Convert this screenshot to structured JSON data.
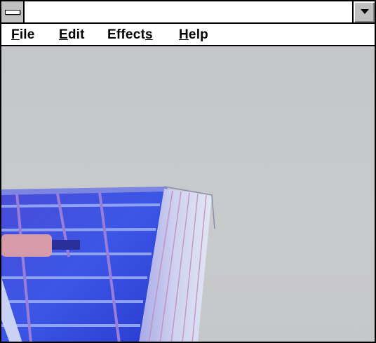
{
  "window": {
    "title": ""
  },
  "menu": {
    "file": {
      "label": "File",
      "access": "F",
      "rest": "ile"
    },
    "edit": {
      "label": "Edit",
      "access": "E",
      "rest": "dit"
    },
    "effects": {
      "label": "Effects",
      "pre": "Effect",
      "access": "s",
      "post": ""
    },
    "help": {
      "label": "Help",
      "access": "H",
      "rest": "elp"
    }
  },
  "icons": {
    "system_menu": "system-menu-icon",
    "minimize": "minimize-arrow-icon"
  },
  "colors": {
    "chrome": "#c0c0c0",
    "titlebar": "#ffffff",
    "sky": "#c6c7c9",
    "building_blue": "#3b3fd6"
  }
}
